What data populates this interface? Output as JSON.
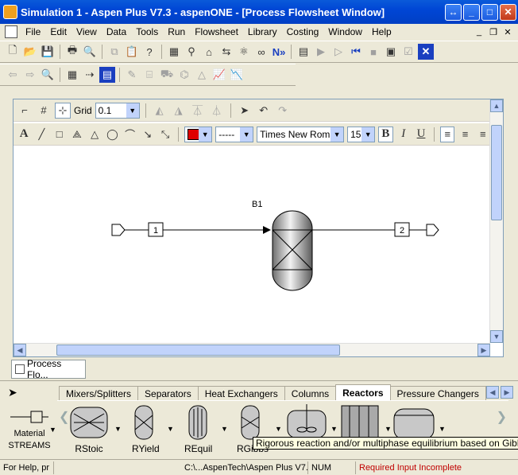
{
  "window": {
    "title": "Simulation 1 - Aspen Plus V7.3 - aspenONE - [Process Flowsheet Window]",
    "buttons": [
      "↔",
      "_",
      "□",
      "✕"
    ]
  },
  "menu": [
    "File",
    "Edit",
    "View",
    "Data",
    "Tools",
    "Run",
    "Flowsheet",
    "Library",
    "Costing",
    "Window",
    "Help"
  ],
  "mdi_controls": [
    "_",
    "❐",
    "✕"
  ],
  "flowsheet_toolbar": {
    "grid_label": "Grid",
    "grid_value": "0.1",
    "line_style": "-----",
    "font_name": "Times New Roman",
    "font_size": "15",
    "bold": "B",
    "italic": "I",
    "underline": "U",
    "text_tool": "A",
    "fill_color": "#e00000"
  },
  "flowsheet": {
    "block_label": "B1",
    "stream_in": "1",
    "stream_out": "2"
  },
  "window_tab": "Process Flo...",
  "library": {
    "tabs": [
      "Mixers/Splitters",
      "Separators",
      "Heat Exchangers",
      "Columns",
      "Reactors",
      "Pressure Changers"
    ],
    "active_tab": "Reactors",
    "streams_top": "Material",
    "streams_bottom": "STREAMS",
    "models": [
      "RStoic",
      "RYield",
      "REquil",
      "RGibbs"
    ],
    "tooltip": "Rigorous reaction and/or multiphase equilibrium based on Gibbs free e"
  },
  "status": {
    "help": "For Help, pr",
    "path": "C:\\...AspenTech\\Aspen Plus V7.3",
    "num": "NUM",
    "input_state": "Required Input Incomplete",
    "input_state_color": "#c00000"
  }
}
